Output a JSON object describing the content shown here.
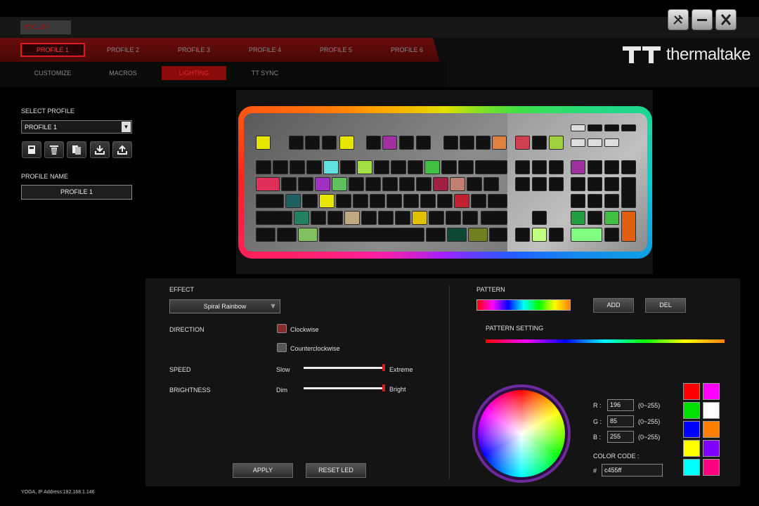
{
  "header": {
    "language": "ENGLISH",
    "brand": "thermaltake",
    "profile_tabs": [
      "PROFILE 1",
      "PROFILE 2",
      "PROFILE 3",
      "PROFILE 4",
      "PROFILE 5",
      "PROFILE 6"
    ],
    "active_profile_tab": 0,
    "sub_tabs": [
      "CUSTOMIZE",
      "MACROS",
      "LIGHTING",
      "TT SYNC"
    ],
    "active_sub_tab": 2,
    "window_buttons": [
      "settings-tools-icon",
      "minimize-icon",
      "close-icon"
    ]
  },
  "sidebar": {
    "select_profile_label": "SELECT PROFILE",
    "selected_profile": "PROFILE 1",
    "action_icons": [
      "save-icon",
      "delete-icon",
      "copy-icon",
      "import-icon",
      "export-icon"
    ],
    "profile_name_label": "PROFILE NAME",
    "profile_name_value": "PROFILE 1",
    "ip_address": "YOGA, IP Address:192.168.1.146"
  },
  "effects": {
    "effect_label": "EFFECT",
    "effect_value": "Spiral Rainbow",
    "direction_label": "DIRECTION",
    "direction_options": [
      "Clockwise",
      "Counterclockwise"
    ],
    "direction_selected": 0,
    "speed_label": "SPEED",
    "speed_min": "Slow",
    "speed_max": "Extreme",
    "speed_level": 1.0,
    "brightness_label": "BRIGHTNESS",
    "brightness_min": "Dim",
    "brightness_max": "Bright",
    "brightness_level": 1.0,
    "apply_label": "APPLY",
    "reset_label": "RESET LED"
  },
  "pattern": {
    "pattern_label": "PATTERN",
    "add_label": "ADD",
    "del_label": "DEL",
    "pattern_setting_label": "PATTERN SETTING"
  },
  "color": {
    "r_label": "R :",
    "g_label": "G :",
    "b_label": "B :",
    "r_value": "196",
    "g_value": "85",
    "b_value": "255",
    "range": "(0~255)",
    "code_label": "COLOR CODE :",
    "hash": "#",
    "code_value": "c455ff",
    "swatches": [
      "#ff0000",
      "#ff00ff",
      "#00e000",
      "#ffffff",
      "#0000ff",
      "#ff8000",
      "#ffff00",
      "#8000ff",
      "#00ffff",
      "#ff0080"
    ]
  }
}
